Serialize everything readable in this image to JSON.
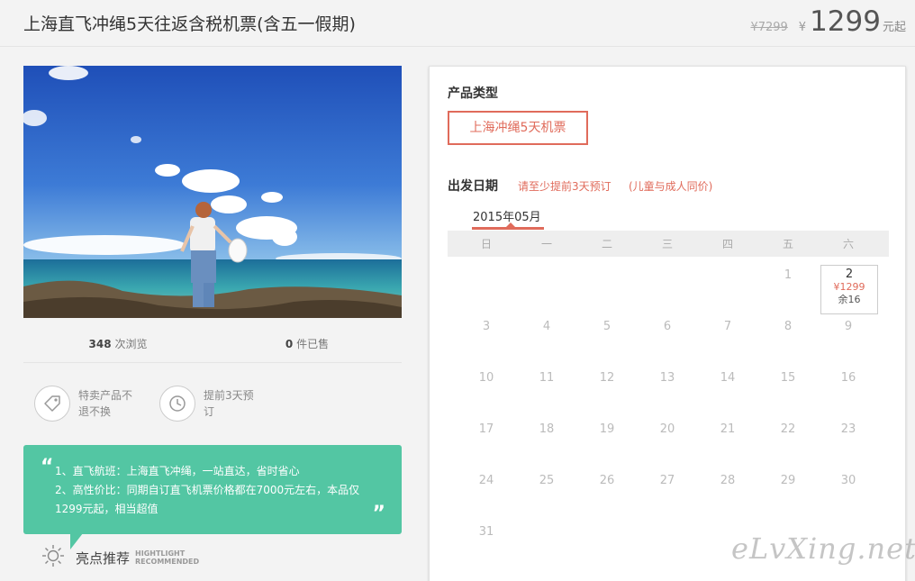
{
  "header": {
    "title": "上海直飞冲绳5天往返含税机票(含五一假期)",
    "old_price": "¥7299",
    "currency": "¥",
    "price": "1299",
    "price_unit": "元起"
  },
  "stats": {
    "views_count": "348",
    "views_label": "次浏览",
    "sold_count": "0",
    "sold_label": "件已售"
  },
  "features": [
    {
      "icon": "tag-icon",
      "text": "特卖产品不退不换"
    },
    {
      "icon": "clock-icon",
      "text": "提前3天预订"
    }
  ],
  "highlight": {
    "open_quote": "“",
    "close_quote": "”",
    "line1": "1、直飞航班：上海直飞冲绳，一站直达，省时省心",
    "line2": "2、高性价比：同期自订直飞机票价格都在7000元左右，本品仅1299元起，相当超值"
  },
  "recommend": {
    "icon": "sun-icon",
    "label": "亮点推荐",
    "en_line1": "HIGHTLIGHT",
    "en_line2": "RECOMMENDED"
  },
  "booking": {
    "product_type_title": "产品类型",
    "product_option": "上海冲绳5天机票",
    "date_title": "出发日期",
    "note1": "请至少提前3天预订",
    "note2": "(儿童与成人同价)",
    "month": "2015年05月",
    "weekdays": [
      "日",
      "一",
      "二",
      "三",
      "四",
      "五",
      "六"
    ],
    "selected_day": {
      "day": "2",
      "price": "¥1299",
      "remain": "余16"
    },
    "days": [
      "1",
      "3",
      "4",
      "5",
      "6",
      "7",
      "8",
      "9",
      "10",
      "11",
      "12",
      "13",
      "14",
      "15",
      "16",
      "17",
      "18",
      "19",
      "20",
      "21",
      "22",
      "23",
      "24",
      "25",
      "26",
      "27",
      "28",
      "29",
      "30",
      "31"
    ]
  },
  "watermark": "eLvXing.net",
  "colors": {
    "accent": "#e06b5b",
    "highlight_bg": "#53c6a3"
  }
}
